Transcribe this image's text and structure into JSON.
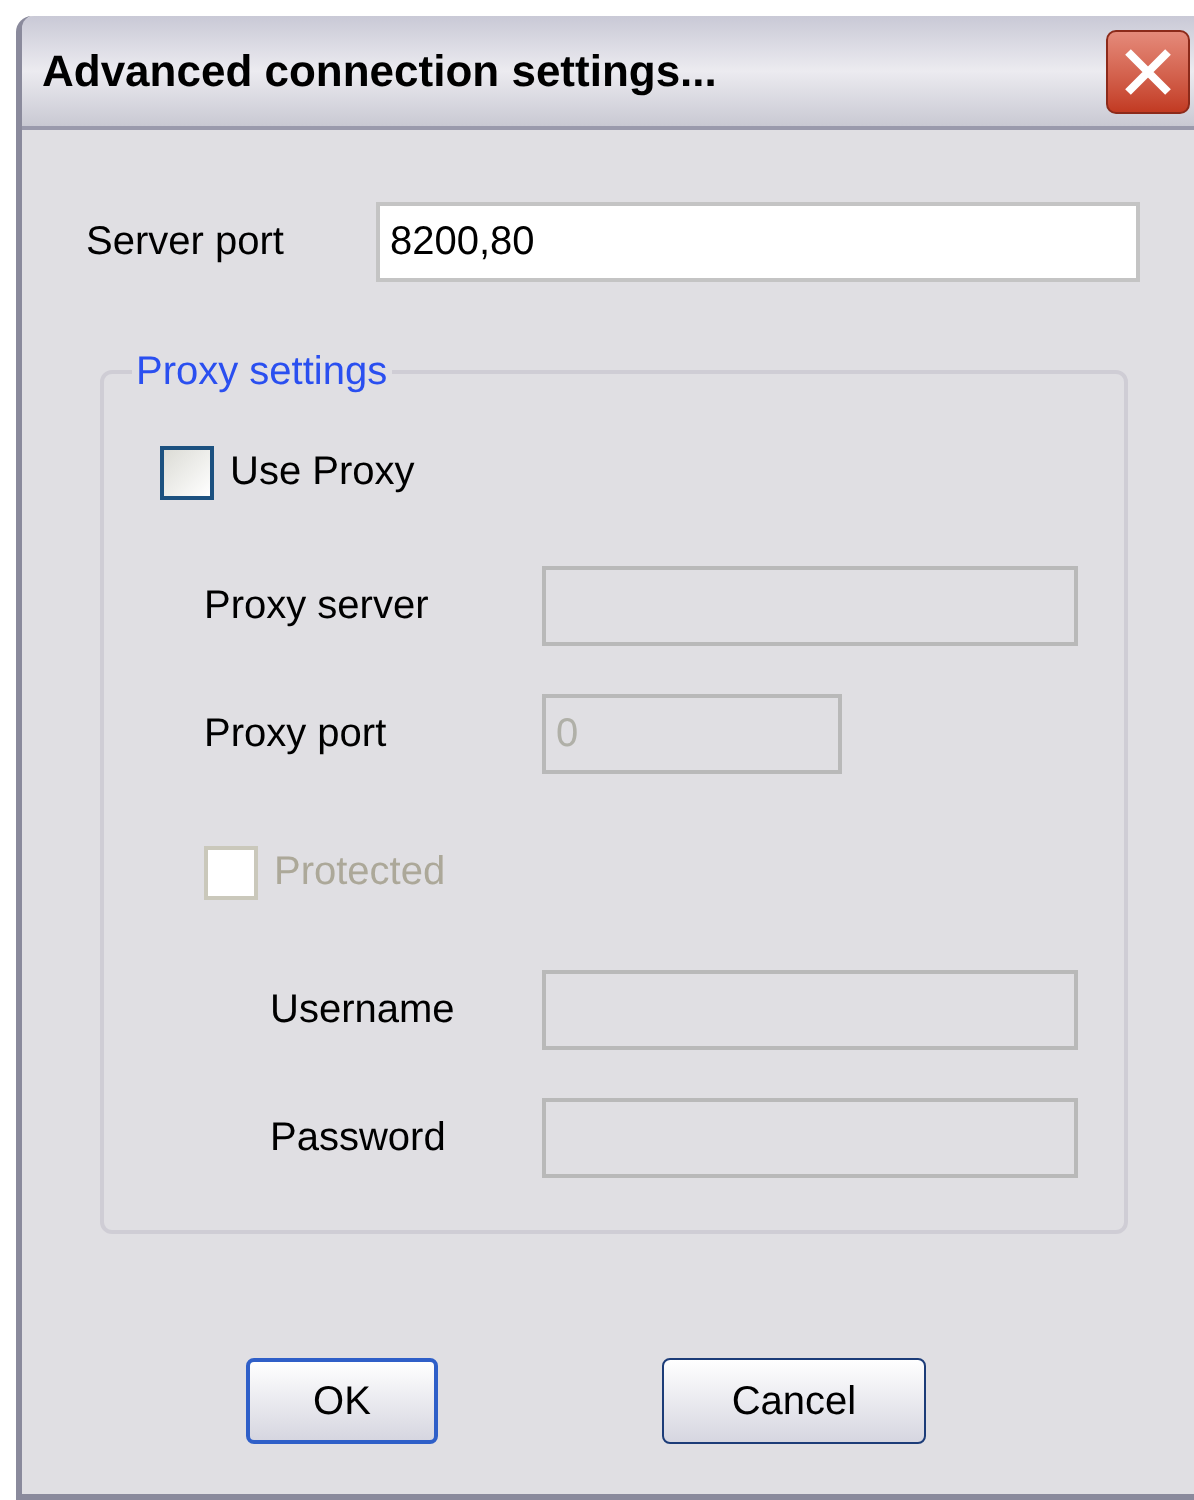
{
  "window": {
    "title": "Advanced connection settings..."
  },
  "server_port": {
    "label": "Server port",
    "value": "8200,80"
  },
  "proxy_group": {
    "title": "Proxy settings",
    "use_proxy": {
      "label": "Use Proxy",
      "checked": false,
      "disabled": false
    },
    "proxy_server": {
      "label": "Proxy server",
      "disabled": true
    },
    "proxy_port": {
      "label": "Proxy port",
      "value": "0",
      "disabled": true
    },
    "protected": {
      "label": "Protected",
      "checked": false,
      "disabled": true
    },
    "username": {
      "label": "Username",
      "disabled": true
    },
    "password": {
      "label": "Password",
      "disabled": true
    }
  },
  "buttons": [
    {
      "label": "OK",
      "default": true
    },
    {
      "label": "Cancel",
      "default": false
    }
  ]
}
